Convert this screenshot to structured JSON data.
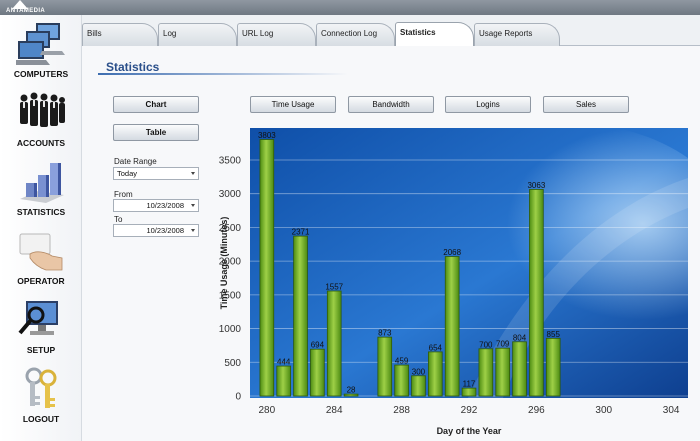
{
  "app": {
    "logo_text": "ANTAMEDIA"
  },
  "sidebar": {
    "items": [
      {
        "label": "COMPUTERS",
        "icon": "computers-icon"
      },
      {
        "label": "ACCOUNTS",
        "icon": "accounts-icon"
      },
      {
        "label": "STATISTICS",
        "icon": "statistics-icon"
      },
      {
        "label": "OPERATOR",
        "icon": "operator-icon"
      },
      {
        "label": "SETUP",
        "icon": "setup-icon"
      },
      {
        "label": "LOGOUT",
        "icon": "logout-icon"
      }
    ]
  },
  "tabs": [
    {
      "label": "Bills"
    },
    {
      "label": "Log"
    },
    {
      "label": "URL Log"
    },
    {
      "label": "Connection Log"
    },
    {
      "label": "Statistics",
      "active": true
    },
    {
      "label": "Usage Reports"
    }
  ],
  "main": {
    "title": "Statistics",
    "view_buttons": {
      "chart": "Chart",
      "table": "Table"
    },
    "metric_buttons": {
      "time_usage": "Time Usage",
      "bandwidth": "Bandwidth",
      "logins": "Logins",
      "sales": "Sales"
    },
    "filters": {
      "date_range_label": "Date Range",
      "date_range_value": "Today",
      "from_label": "From",
      "from_value": "10/23/2008",
      "to_label": "To",
      "to_value": "10/23/2008"
    }
  },
  "chart_data": {
    "type": "bar",
    "xlabel": "Day of the Year",
    "ylabel": "Time Usage (Minutes)",
    "x": [
      280,
      281,
      282,
      283,
      284,
      285,
      287,
      288,
      289,
      290,
      291,
      292,
      293,
      294,
      295,
      296,
      297
    ],
    "values": [
      3803,
      444,
      2371,
      694,
      1557,
      28,
      873,
      459,
      300,
      654,
      2068,
      117,
      700,
      709,
      804,
      3063,
      855
    ],
    "xlim": [
      279,
      305
    ],
    "ylim": [
      0,
      3900
    ],
    "x_ticks": [
      280,
      284,
      288,
      292,
      296,
      300,
      304
    ],
    "y_ticks": [
      0,
      500,
      1000,
      1500,
      2000,
      2500,
      3000,
      3500
    ],
    "grid": "horizontal",
    "colors": {
      "bar": "#7fba2c",
      "bar_edge": "#2f5a0a",
      "background": "#1f62b8"
    }
  }
}
